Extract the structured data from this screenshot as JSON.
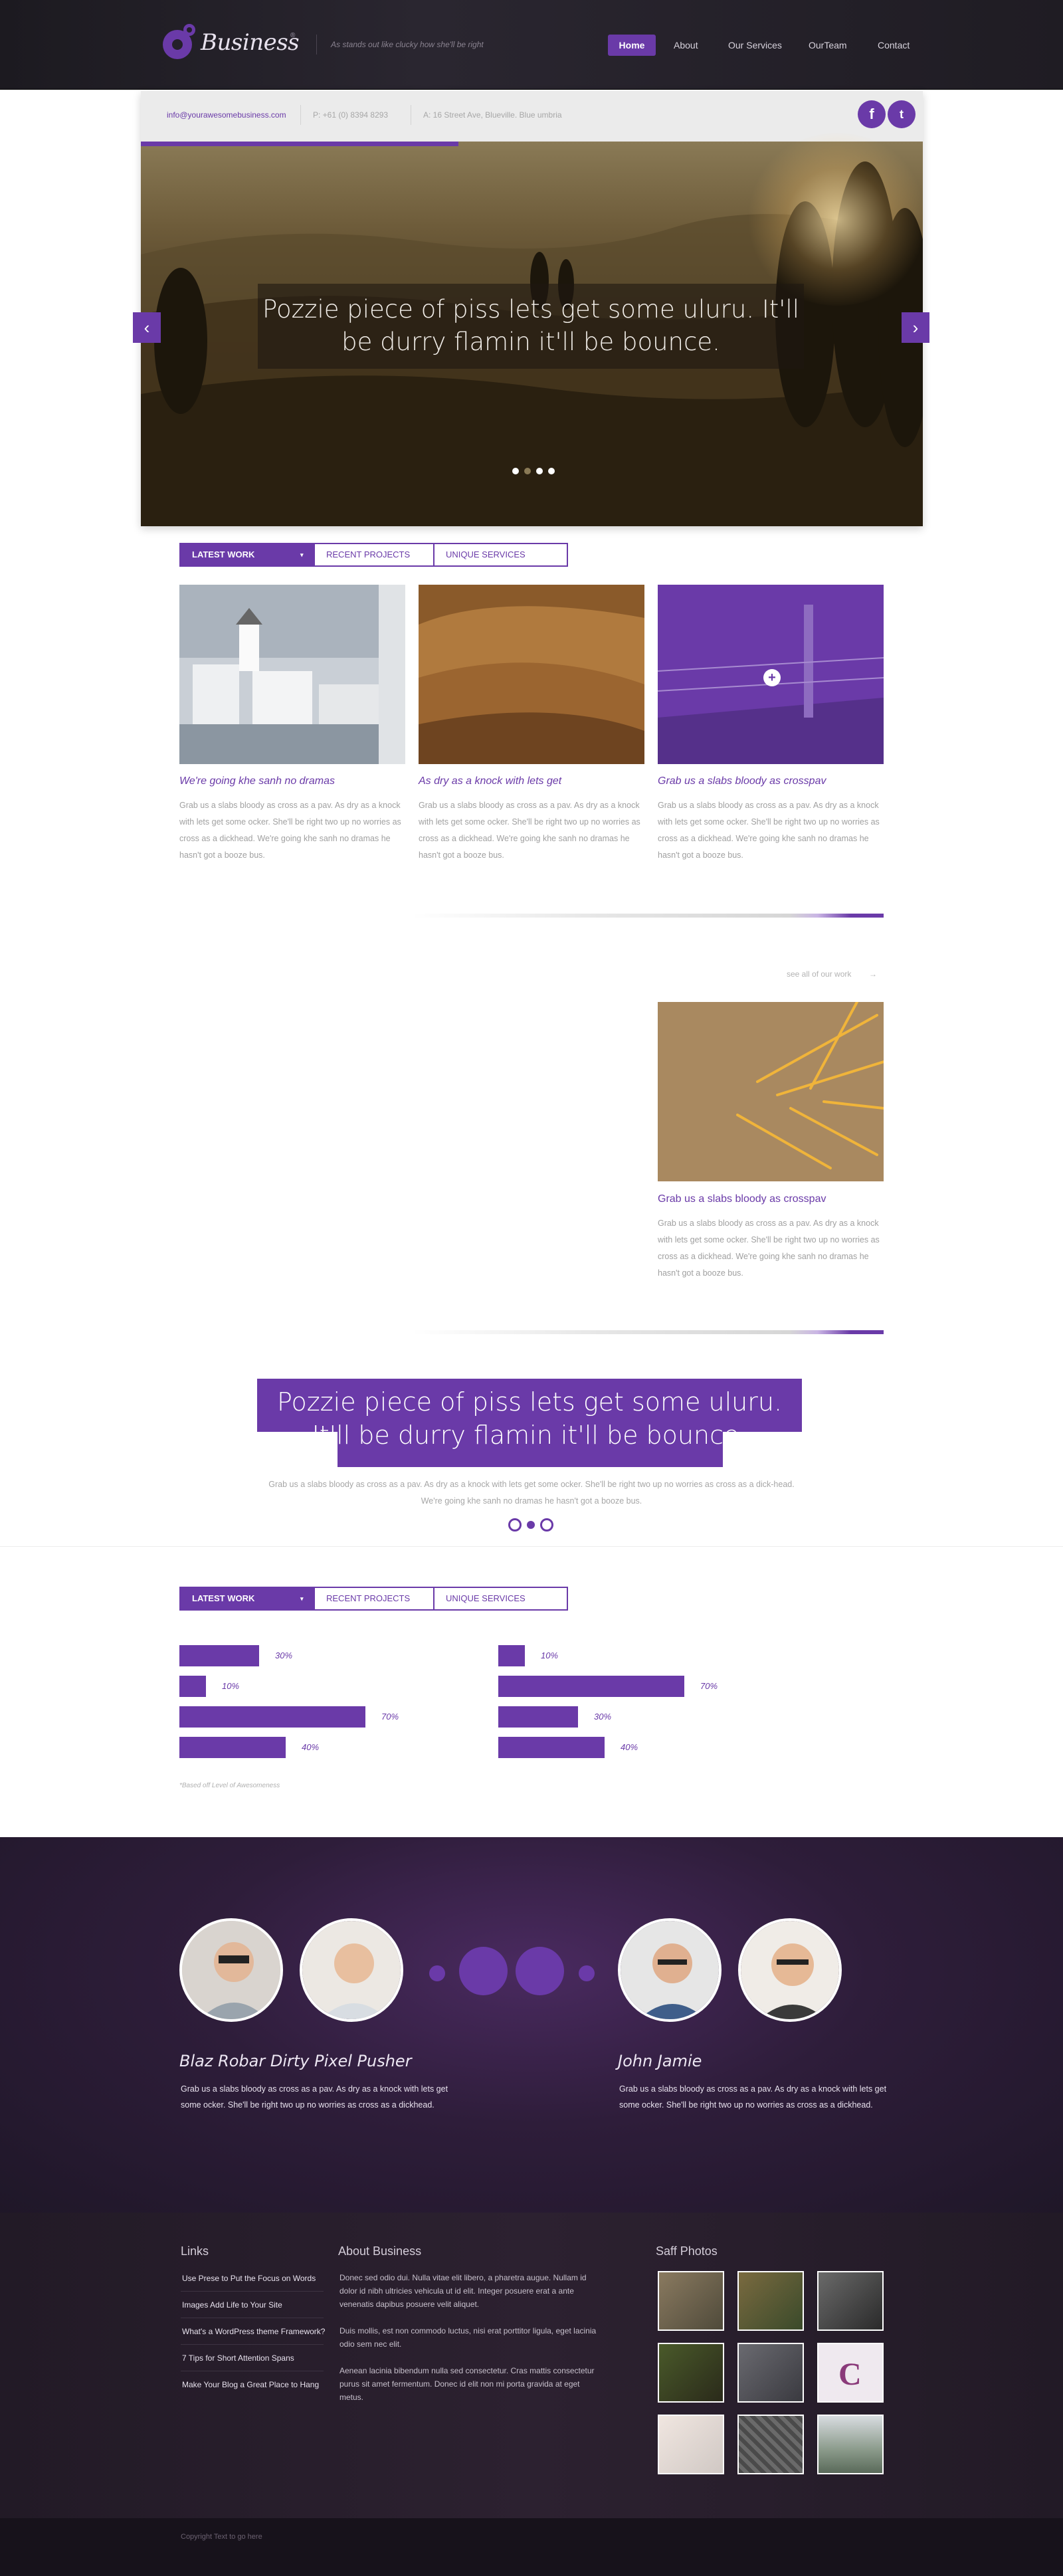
{
  "header": {
    "logo_text": "Business",
    "logo_sup": "®",
    "tagline": "As stands out like clucky how she'll be right",
    "nav": [
      "Home",
      "About",
      "Our Services",
      "OurTeam",
      "Contact"
    ]
  },
  "topbar": {
    "email": "info@yourawesomebusiness.com",
    "phone": "P: +61 (0) 8394 8293",
    "address": "A: 16 Street Ave, Blueville. Blue umbria",
    "social": [
      "f",
      "t"
    ]
  },
  "hero": {
    "caption": "Pozzie piece of piss lets get some uluru. It'll be durry flamin it'll be bounce.",
    "prev": "‹",
    "next": "›"
  },
  "tabs": {
    "items": [
      "LATEST WORK",
      "RECENT PROJECTS",
      "UNIQUE SERVICES"
    ],
    "caret": "▾"
  },
  "portfolio": [
    {
      "title": "We're going khe sanh no dramas",
      "text": "Grab us a slabs bloody as cross as a pav. As dry as a knock with lets get some ocker. She'll be right two up no worries as cross as a dickhead. We're going khe sanh no dramas he hasn't got a booze bus."
    },
    {
      "title": "As dry as a knock with lets get",
      "text": "Grab us a slabs bloody as cross as a pav. As dry as a knock with lets get some ocker. She'll be right two up no worries as cross as a dickhead. We're going khe sanh no dramas he hasn't got a booze bus."
    },
    {
      "title": "Grab us a slabs bloody as crosspav",
      "text": "Grab us a slabs bloody as cross as a pav. As dry as a knock with lets get some ocker. She'll be right two up no worries as cross as a dickhead. We're going khe sanh no dramas he hasn't got a booze bus."
    }
  ],
  "see_all": "see all of our work",
  "see_all_arrow": "→",
  "portfolio_extra": {
    "title": "Grab us a slabs bloody as crosspav",
    "text": "Grab us a slabs bloody as cross as a pav. As dry as a knock with lets get some ocker. She'll be right two up no worries as cross as a dickhead. We're going khe sanh no dramas he hasn't got a booze bus."
  },
  "quote": {
    "text": "Pozzie piece of piss lets get some uluru. It'll be durry flamin it'll be bounce.",
    "sub": "Grab us a slabs bloody as cross as a pav. As dry as a knock with lets get some ocker. She'll be right two up no worries as cross as a dick-head. We're going khe sanh no dramas he hasn't got a booze bus."
  },
  "skills": {
    "left": [
      {
        "label": "30%",
        "value": 30
      },
      {
        "label": "10%",
        "value": 10
      },
      {
        "label": "70%",
        "value": 70
      },
      {
        "label": "40%",
        "value": 40
      }
    ],
    "right": [
      {
        "label": "10%",
        "value": 10
      },
      {
        "label": "70%",
        "value": 70
      },
      {
        "label": "30%",
        "value": 30
      },
      {
        "label": "40%",
        "value": 40
      }
    ],
    "note": "*Based off Level of Awesomeness"
  },
  "team": [
    {
      "name": "Blaz Robar Dirty Pixel Pusher",
      "text": "Grab us a slabs bloody as cross as a pav. As dry as a knock with lets get some ocker. She'll be right two up no worries as cross as a dickhead."
    },
    {
      "name": "John Jamie",
      "text": "Grab us a slabs bloody as cross as a pav. As dry as a knock with lets get some ocker. She'll be right two up no worries as cross as a dickhead."
    }
  ],
  "footer": {
    "links_title": "Links",
    "links": [
      "Use Prese to Put the Focus on Words",
      "Images Add Life to Your Site",
      "What's a WordPress theme Framework?",
      "7 Tips for Short Attention Spans",
      "Make Your Blog a Great Place to Hang"
    ],
    "about_title": "About Business",
    "about": [
      "Donec sed odio dui. Nulla vitae elit libero, a pharetra augue. Nullam id dolor id nibh ultricies vehicula ut id elit. Integer posuere erat a ante venenatis dapibus posuere velit aliquet.",
      "Duis mollis, est non commodo luctus, nisi erat porttitor ligula, eget lacinia odio sem nec elit.",
      "Aenean lacinia bibendum nulla sed consectetur. Cras mattis consectetur purus sit amet fermentum. Donec id elit non mi porta gravida at eget metus."
    ],
    "photos_title": "Saff Photos",
    "copyright": "Copyright Text to go here"
  },
  "colors": {
    "accent": "#6a3aa8",
    "dark": "#1f1c23"
  }
}
